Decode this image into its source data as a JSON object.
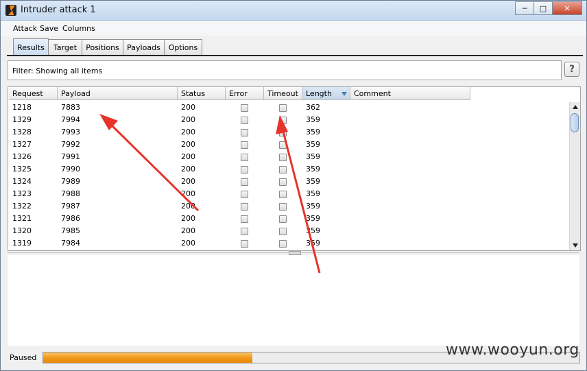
{
  "window": {
    "title": "Intruder attack 1"
  },
  "menu": [
    "Attack",
    "Save",
    "Columns"
  ],
  "tabs": [
    {
      "label": "Results",
      "active": true
    },
    {
      "label": "Target",
      "active": false
    },
    {
      "label": "Positions",
      "active": false
    },
    {
      "label": "Payloads",
      "active": false
    },
    {
      "label": "Options",
      "active": false
    }
  ],
  "filter": {
    "text": "Filter:  Showing all items",
    "help_label": "?"
  },
  "table": {
    "columns": [
      "Request",
      "Payload",
      "Status",
      "Error",
      "Timeout",
      "Length",
      "Comment"
    ],
    "sorted_column": "Length",
    "rows": [
      {
        "request": "1218",
        "payload": "7883",
        "status": "200",
        "error": false,
        "timeout": false,
        "length": "362",
        "comment": ""
      },
      {
        "request": "1329",
        "payload": "7994",
        "status": "200",
        "error": false,
        "timeout": false,
        "length": "359",
        "comment": ""
      },
      {
        "request": "1328",
        "payload": "7993",
        "status": "200",
        "error": false,
        "timeout": false,
        "length": "359",
        "comment": ""
      },
      {
        "request": "1327",
        "payload": "7992",
        "status": "200",
        "error": false,
        "timeout": false,
        "length": "359",
        "comment": ""
      },
      {
        "request": "1326",
        "payload": "7991",
        "status": "200",
        "error": false,
        "timeout": false,
        "length": "359",
        "comment": ""
      },
      {
        "request": "1325",
        "payload": "7990",
        "status": "200",
        "error": false,
        "timeout": false,
        "length": "359",
        "comment": ""
      },
      {
        "request": "1324",
        "payload": "7989",
        "status": "200",
        "error": false,
        "timeout": false,
        "length": "359",
        "comment": ""
      },
      {
        "request": "1323",
        "payload": "7988",
        "status": "200",
        "error": false,
        "timeout": false,
        "length": "359",
        "comment": ""
      },
      {
        "request": "1322",
        "payload": "7987",
        "status": "200",
        "error": false,
        "timeout": false,
        "length": "359",
        "comment": ""
      },
      {
        "request": "1321",
        "payload": "7986",
        "status": "200",
        "error": false,
        "timeout": false,
        "length": "359",
        "comment": ""
      },
      {
        "request": "1320",
        "payload": "7985",
        "status": "200",
        "error": false,
        "timeout": false,
        "length": "359",
        "comment": ""
      },
      {
        "request": "1319",
        "payload": "7984",
        "status": "200",
        "error": false,
        "timeout": false,
        "length": "359",
        "comment": ""
      }
    ]
  },
  "status": {
    "label": "Paused",
    "progress": 0.39
  },
  "watermark": "www.wooyun.org",
  "colors": {
    "progress": "#f29a1a",
    "annotation_arrow": "#e8332a",
    "sort_arrow": "#4a7bb5"
  },
  "icons": [
    "burp-app-icon",
    "minimize-icon",
    "maximize-icon",
    "close-icon",
    "help-icon",
    "sort-desc-icon",
    "scroll-up-icon",
    "scroll-down-icon"
  ]
}
